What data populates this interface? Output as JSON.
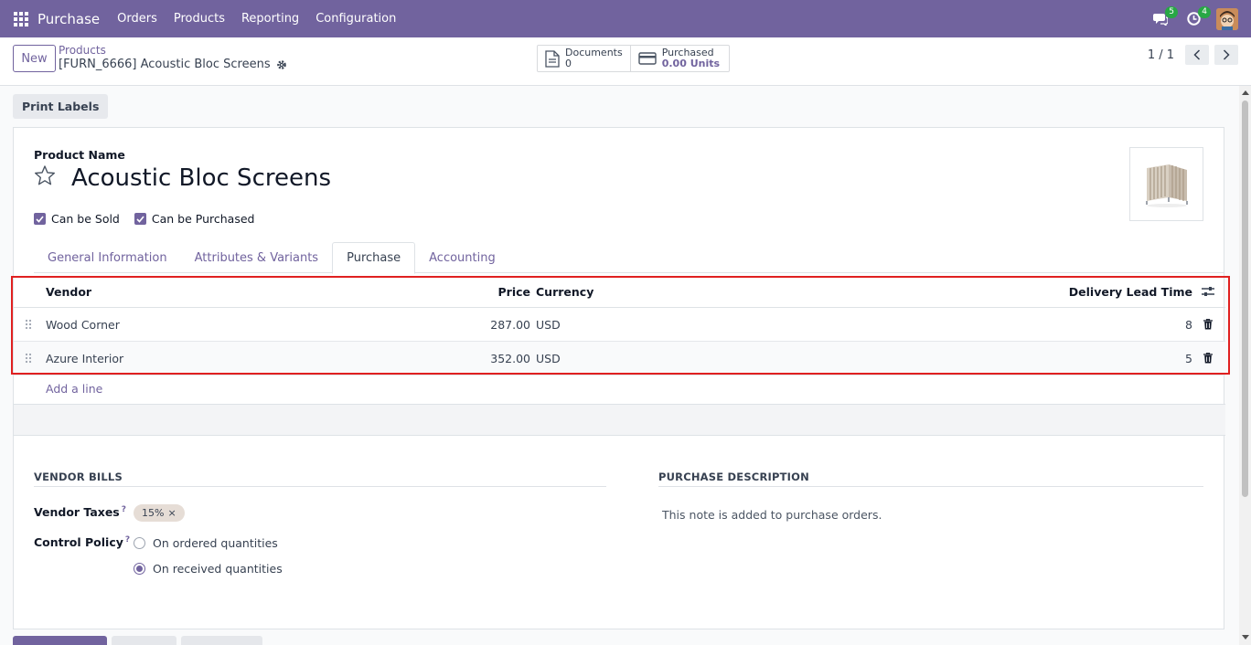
{
  "navbar": {
    "app_name": "Purchase",
    "menu": [
      "Orders",
      "Products",
      "Reporting",
      "Configuration"
    ],
    "messages_badge": "5",
    "activities_badge": "4",
    "icons": [
      "apps-grid-icon",
      "chat-icon",
      "clock-icon",
      "user-avatar"
    ]
  },
  "control_panel": {
    "new_label": "New",
    "breadcrumb_parent": "Products",
    "breadcrumb_current": "[FURN_6666] Acoustic Bloc Screens",
    "stats": [
      {
        "label": "Documents",
        "value": "0",
        "icon": "document-icon"
      },
      {
        "label": "Purchased",
        "value": "0.00 Units",
        "icon": "credit-card-icon"
      }
    ],
    "pager": "1 / 1"
  },
  "actions": {
    "print_labels": "Print Labels"
  },
  "form": {
    "product_name_label": "Product Name",
    "product_name": "Acoustic Bloc Screens",
    "checkboxes": [
      {
        "label": "Can be Sold",
        "checked": true
      },
      {
        "label": "Can be Purchased",
        "checked": true
      }
    ],
    "tabs": [
      "General Information",
      "Attributes & Variants",
      "Purchase",
      "Accounting"
    ],
    "active_tab": "Purchase"
  },
  "vendor_table": {
    "headers": {
      "vendor": "Vendor",
      "price": "Price",
      "currency": "Currency",
      "lead_time": "Delivery Lead Time"
    },
    "rows": [
      {
        "vendor": "Wood Corner",
        "price": "287.00",
        "currency": "USD",
        "lead_time": "8"
      },
      {
        "vendor": "Azure Interior",
        "price": "352.00",
        "currency": "USD",
        "lead_time": "5"
      }
    ],
    "add_line": "Add a line"
  },
  "vendor_bills": {
    "title": "VENDOR BILLS",
    "vendor_taxes_label": "Vendor Taxes",
    "vendor_taxes_tag": "15%",
    "control_policy_label": "Control Policy",
    "help_mark": "?",
    "policy_options": [
      {
        "label": "On ordered quantities",
        "selected": false
      },
      {
        "label": "On received quantities",
        "selected": true
      }
    ]
  },
  "purchase_description": {
    "title": "PURCHASE DESCRIPTION",
    "note": "This note is added to purchase orders."
  },
  "colors": {
    "brand": "#71639e",
    "highlight": "#e02020",
    "badge": "#28a745"
  }
}
